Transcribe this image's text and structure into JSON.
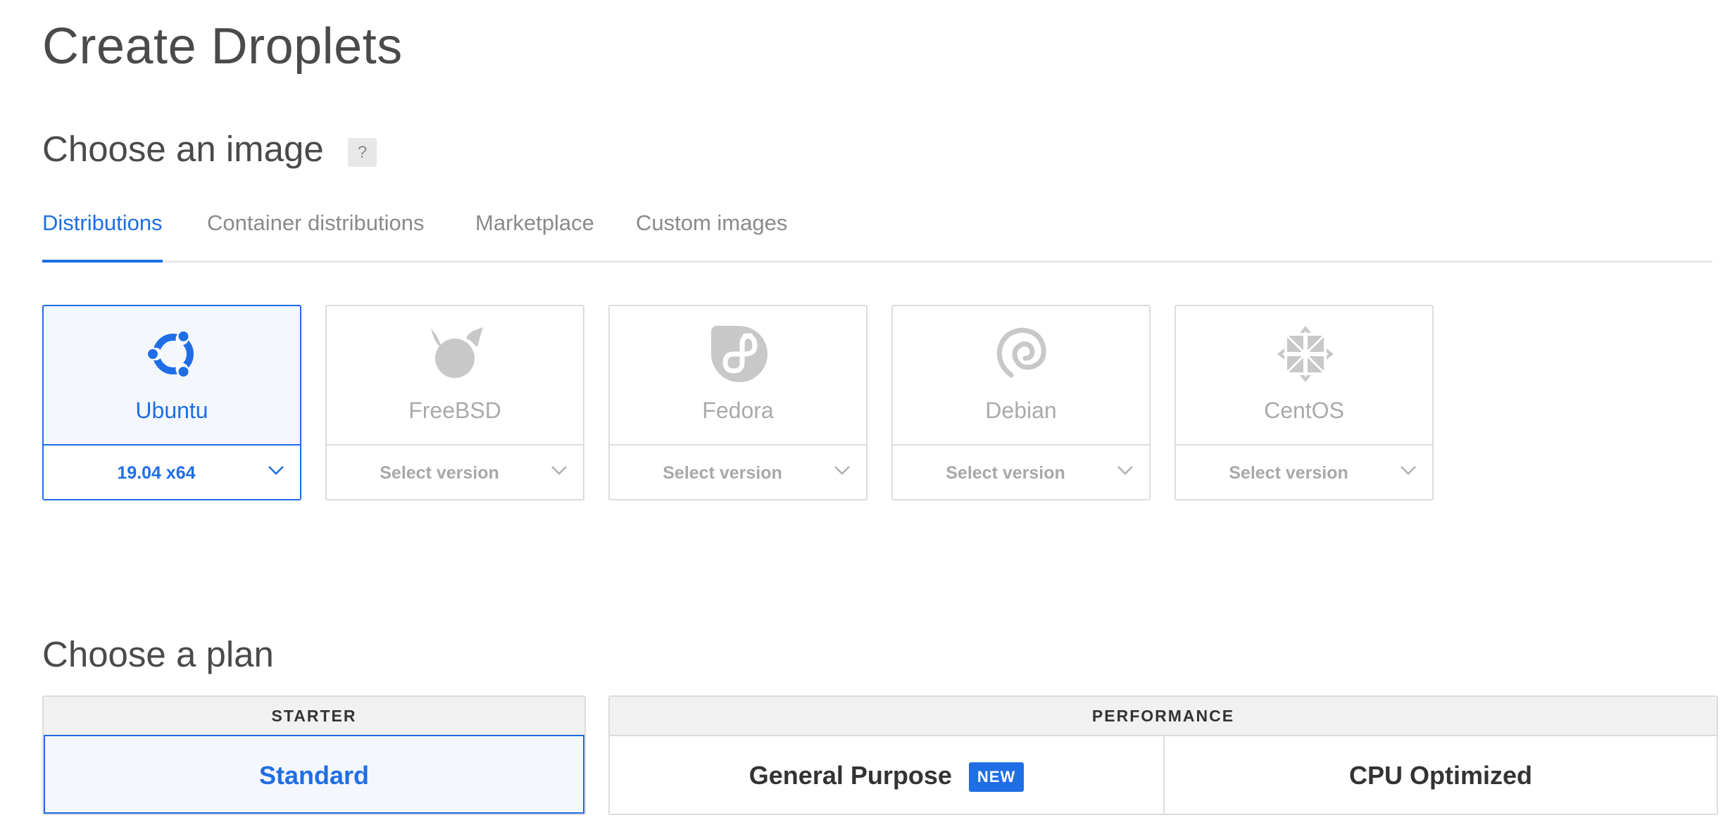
{
  "page_title": "Create Droplets",
  "image_section": {
    "title": "Choose an image",
    "help": "?",
    "tabs": [
      {
        "label": "Distributions",
        "active": true
      },
      {
        "label": "Container distributions",
        "active": false
      },
      {
        "label": "Marketplace",
        "active": false
      },
      {
        "label": "Custom images",
        "active": false
      }
    ],
    "distributions": [
      {
        "name": "Ubuntu",
        "version": "19.04 x64",
        "selected": true,
        "icon": "ubuntu-icon"
      },
      {
        "name": "FreeBSD",
        "version": "Select version",
        "selected": false,
        "icon": "freebsd-icon"
      },
      {
        "name": "Fedora",
        "version": "Select version",
        "selected": false,
        "icon": "fedora-icon"
      },
      {
        "name": "Debian",
        "version": "Select version",
        "selected": false,
        "icon": "debian-icon"
      },
      {
        "name": "CentOS",
        "version": "Select version",
        "selected": false,
        "icon": "centos-icon"
      }
    ]
  },
  "plan_section": {
    "title": "Choose a plan",
    "groups": [
      {
        "label": "STARTER",
        "options": [
          {
            "label": "Standard",
            "selected": true
          }
        ]
      },
      {
        "label": "PERFORMANCE",
        "options": [
          {
            "label": "General Purpose",
            "badge": "NEW",
            "selected": false
          },
          {
            "label": "CPU Optimized",
            "selected": false
          }
        ]
      }
    ]
  },
  "colors": {
    "accent": "#1f6ee6",
    "muted": "#aaaaaa",
    "border": "#dcdcdc"
  }
}
